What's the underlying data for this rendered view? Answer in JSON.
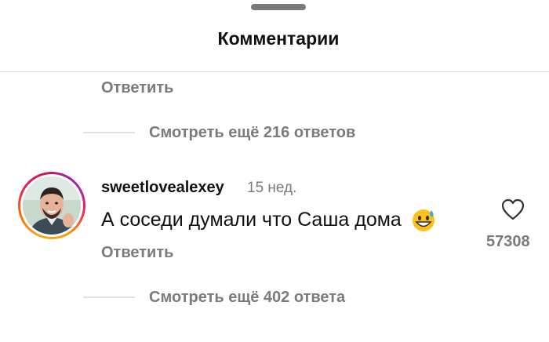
{
  "sheet": {
    "title": "Комментарии"
  },
  "top_reply": {
    "reply_label": "Ответить"
  },
  "thread_1": {
    "view_replies_label": "Смотреть ещё 216 ответов"
  },
  "comment": {
    "username": "sweetlovealexey",
    "timestamp": "15 нед.",
    "text": "А соседи думали что Саша дома",
    "emoji": "grinning-face-with-sweat",
    "reply_label": "Ответить",
    "like_icon": "heart-outline-icon",
    "like_count": "57308"
  },
  "thread_2": {
    "view_replies_label": "Смотреть ещё 402 ответа"
  },
  "colors": {
    "secondary_text": "#7b7b7b",
    "primary_text": "#111111",
    "divider": "#dedede"
  }
}
